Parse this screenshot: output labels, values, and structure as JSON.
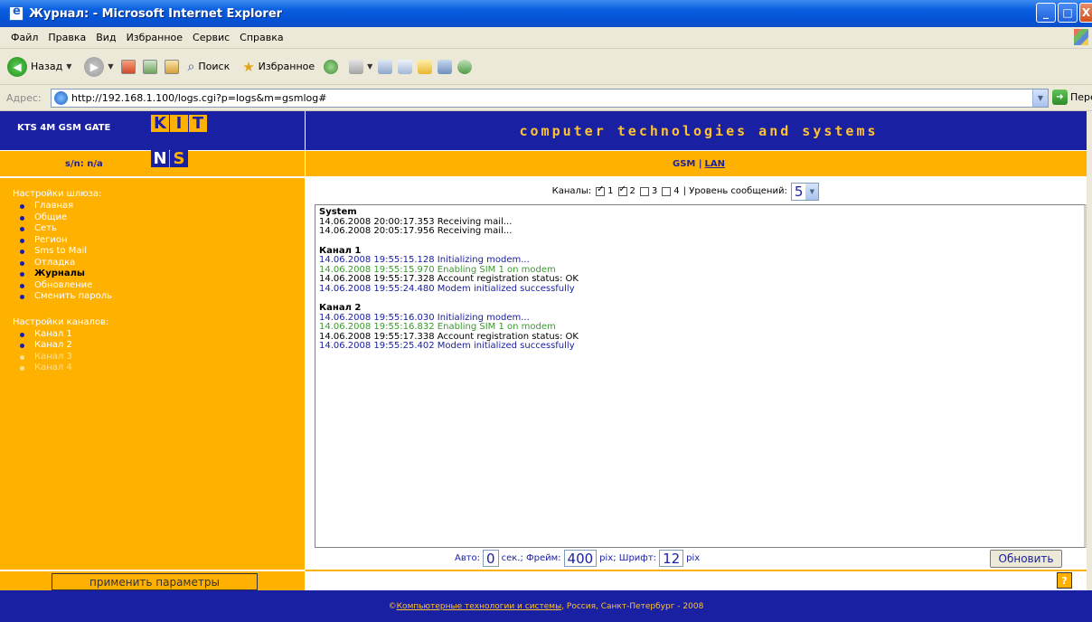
{
  "window": {
    "title": "Журнал: - Microsoft Internet Explorer",
    "buttons": [
      "_",
      "□",
      "X"
    ]
  },
  "menubar": [
    "Файл",
    "Правка",
    "Вид",
    "Избранное",
    "Сервис",
    "Справка"
  ],
  "toolbar": {
    "back": "Назад",
    "search": "Поиск",
    "favorites": "Избранное"
  },
  "address": {
    "label": "Адрес:",
    "url": "http://192.168.1.100/logs.cgi?p=logs&m=gsmlog#",
    "go": "Переход"
  },
  "header": {
    "device": "KTS 4M GSM GATE",
    "serial": "s/n: n/a",
    "banner": "computer technologies and systems",
    "mode_gsm": "GSM |",
    "mode_lan": "LAN"
  },
  "nav": {
    "gateway_heading": "Настройки шлюза:",
    "gateway_items": [
      {
        "label": "Главная",
        "state": "normal"
      },
      {
        "label": "Общие",
        "state": "normal"
      },
      {
        "label": "Сеть",
        "state": "normal"
      },
      {
        "label": "Регион",
        "state": "normal"
      },
      {
        "label": "Sms to Mail",
        "state": "normal"
      },
      {
        "label": "Отладка",
        "state": "normal"
      },
      {
        "label": "Журналы",
        "state": "active"
      },
      {
        "label": "Обновление",
        "state": "normal"
      },
      {
        "label": "Сменить пароль",
        "state": "normal"
      }
    ],
    "channels_heading": "Настройки каналов:",
    "channel_items": [
      {
        "label": "Канал 1",
        "state": "normal"
      },
      {
        "label": "Канал 2",
        "state": "normal"
      },
      {
        "label": "Канал 3",
        "state": "disabled"
      },
      {
        "label": "Канал 4",
        "state": "disabled"
      }
    ]
  },
  "filter": {
    "channels_label": "Каналы:",
    "channels": [
      {
        "label": "1",
        "checked": true
      },
      {
        "label": "2",
        "checked": true
      },
      {
        "label": "3",
        "checked": false
      },
      {
        "label": "4",
        "checked": false
      }
    ],
    "level_label": "| Уровень сообщений:",
    "level_value": "5"
  },
  "log": [
    {
      "title": "System",
      "lines": [
        {
          "text": "14.06.2008 20:00:17.353 Receiving mail...",
          "color": "black"
        },
        {
          "text": "14.06.2008 20:05:17.956 Receiving mail...",
          "color": "black"
        }
      ]
    },
    {
      "title": "Канал 1",
      "lines": [
        {
          "text": "14.06.2008 19:55:15.128 Initializing modem...",
          "color": "blue"
        },
        {
          "text": "14.06.2008 19:55:15.970 Enabling SIM 1 on modem",
          "color": "green"
        },
        {
          "text": "14.06.2008 19:55:17.328 Account registration status: OK",
          "color": "black"
        },
        {
          "text": "14.06.2008 19:55:24.480 Modem initialized successfully",
          "color": "blue"
        }
      ]
    },
    {
      "title": "Канал 2",
      "lines": [
        {
          "text": "14.06.2008 19:55:16.030 Initializing modem...",
          "color": "blue"
        },
        {
          "text": "14.06.2008 19:55:16.832 Enabling SIM 1 on modem",
          "color": "green"
        },
        {
          "text": "14.06.2008 19:55:17.338 Account registration status: OK",
          "color": "black"
        },
        {
          "text": "14.06.2008 19:55:25.402 Modem initialized successfully",
          "color": "blue"
        }
      ]
    }
  ],
  "controls": {
    "auto_label": "Авто:",
    "auto_value": "0",
    "auto_unit": "сек.; Фрейм:",
    "frame_value": "400",
    "frame_unit": "pix; Шрифт:",
    "font_value": "12",
    "font_unit": "pix",
    "refresh": "Обновить",
    "apply": "применить параметры",
    "help": "?"
  },
  "footer": {
    "prefix": "© ",
    "link": "Компьютерные технологии и системы",
    "suffix": ", Россия, Санкт-Петербург - 2008"
  },
  "colors": {
    "brand_blue": "#1a20a2",
    "brand_orange": "#ffb100",
    "log_green": "#3a9a30"
  }
}
